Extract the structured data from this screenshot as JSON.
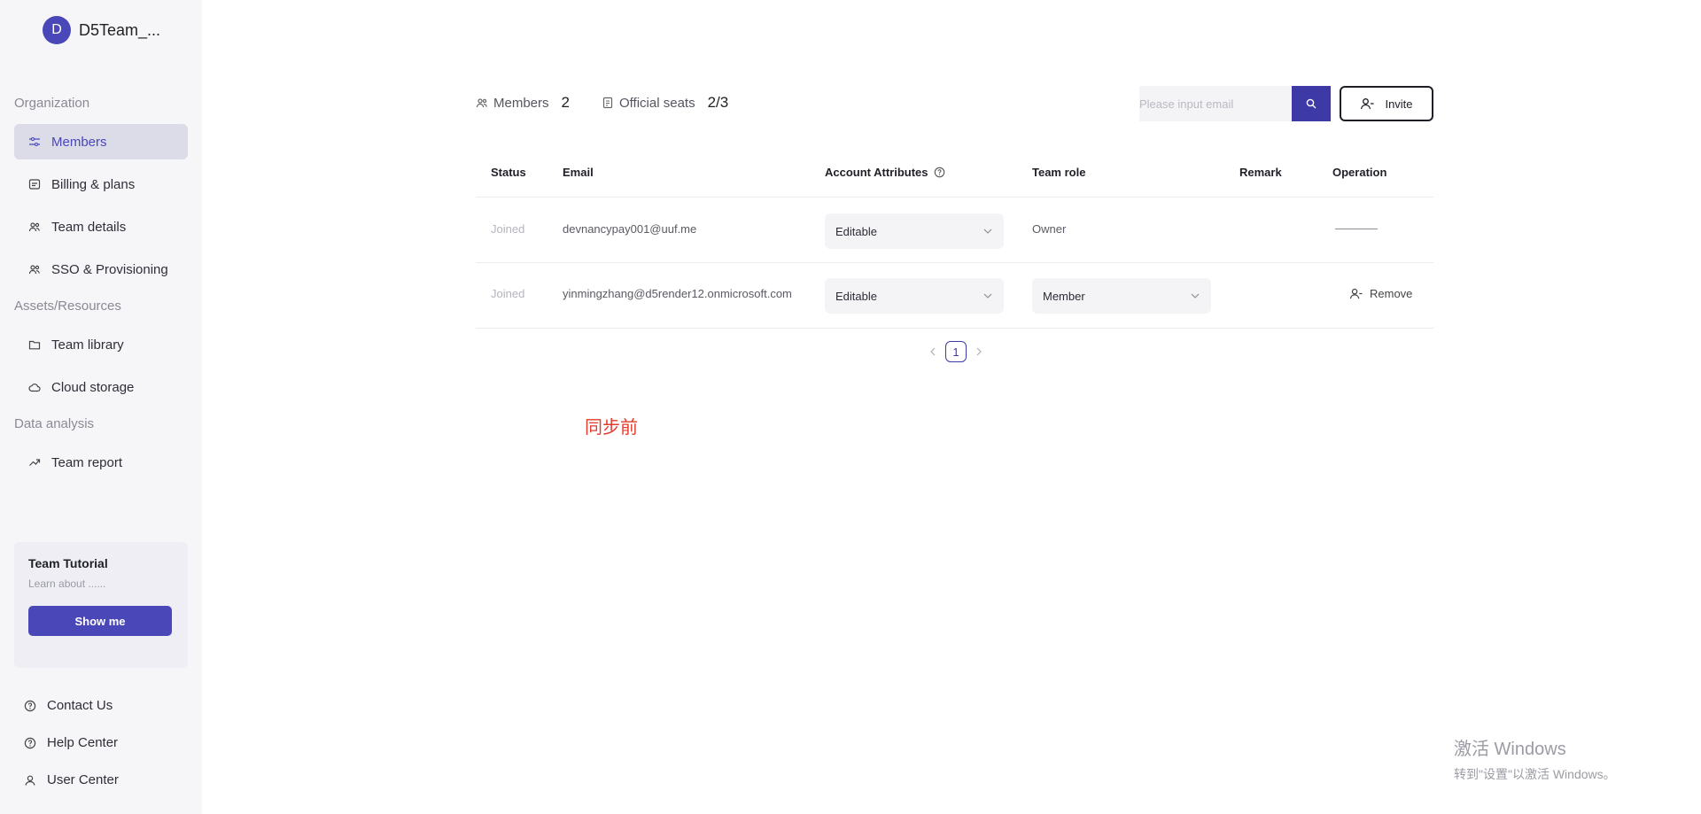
{
  "team": {
    "initial": "D",
    "name": "D5Team_..."
  },
  "sidebar": {
    "sections": {
      "organization": "Organization",
      "assets": "Assets/Resources",
      "data": "Data analysis"
    },
    "items": [
      {
        "label": "Members",
        "icon": "members-sliders-icon",
        "active": true
      },
      {
        "label": "Billing & plans",
        "icon": "billing-icon"
      },
      {
        "label": "Team details",
        "icon": "team-icon"
      },
      {
        "label": "SSO & Provisioning",
        "icon": "sso-icon"
      },
      {
        "label": "Team library",
        "icon": "folder-icon"
      },
      {
        "label": "Cloud storage",
        "icon": "cloud-icon"
      },
      {
        "label": "Team report",
        "icon": "trend-icon"
      }
    ],
    "tutorial": {
      "title": "Team Tutorial",
      "subtitle": "Learn about ......",
      "button": "Show me"
    },
    "footer": [
      {
        "label": "Contact Us",
        "icon": "question-circle-icon"
      },
      {
        "label": "Help Center",
        "icon": "question-circle-icon"
      },
      {
        "label": "User Center",
        "icon": "user-icon"
      }
    ]
  },
  "stats": {
    "members_label": "Members",
    "members_value": "2",
    "seats_label": "Official seats",
    "seats_value": "2/3"
  },
  "search": {
    "placeholder": "Please input email"
  },
  "invite": {
    "label": "Invite"
  },
  "table": {
    "headers": [
      "Status",
      "Email",
      "Account Attributes",
      "Team role",
      "Remark",
      "Operation"
    ],
    "rows": [
      {
        "status": "Joined",
        "email": "devnancypay001@uuf.me",
        "attributes": "Editable",
        "role": "Owner",
        "remark": "",
        "operation": ""
      },
      {
        "status": "Joined",
        "email": "yinmingzhang@d5render12.onmicrosoft.com",
        "attributes": "Editable",
        "role": "Member",
        "remark": "",
        "operation": "Remove"
      }
    ]
  },
  "pagination": {
    "current": "1"
  },
  "annotation": "同步前",
  "watermark": {
    "line1": "激活 Windows",
    "line2": "转到\"设置\"以激活 Windows。"
  },
  "colors": {
    "accent": "#4a47b8",
    "annotation": "#e23b2e"
  }
}
